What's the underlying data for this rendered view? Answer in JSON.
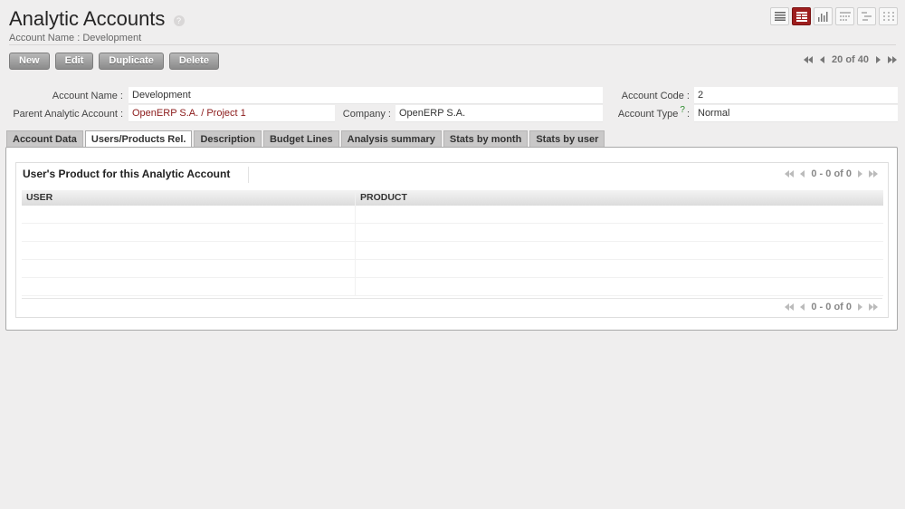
{
  "header": {
    "title": "Analytic Accounts",
    "help": "?",
    "subtitle": "Account Name : Development"
  },
  "view_switch": [
    "list-view-icon",
    "form-view-icon",
    "graph-view-icon",
    "calendar-view-icon",
    "gantt-view-icon",
    "kanban-view-icon"
  ],
  "actions": {
    "new": "New",
    "edit": "Edit",
    "duplicate": "Duplicate",
    "delete": "Delete"
  },
  "pager": {
    "text": "20 of 40"
  },
  "form": {
    "account_name_label": "Account Name :",
    "account_name": "Development",
    "account_code_label": "Account Code :",
    "account_code": "2",
    "parent_label": "Parent Analytic Account :",
    "parent": "OpenERP S.A. / Project 1",
    "company_label": "Company :",
    "company": "OpenERP S.A.",
    "account_type_label": "Account Type",
    "account_type_help": "?",
    "account_type_colon": ":",
    "account_type": "Normal"
  },
  "tabs": [
    "Account Data",
    "Users/Products Rel.",
    "Description",
    "Budget Lines",
    "Analysis summary",
    "Stats by month",
    "Stats by user"
  ],
  "active_tab": "Users/Products Rel.",
  "panel": {
    "title": "User's Product for this Analytic Account",
    "pager_top": "0 - 0 of 0",
    "pager_bottom": "0 - 0 of 0",
    "columns": [
      "USER",
      "PRODUCT"
    ]
  },
  "colors": {
    "accent": "#9e1e1e",
    "link": "#8b1a1a",
    "background": "#efeeee"
  }
}
